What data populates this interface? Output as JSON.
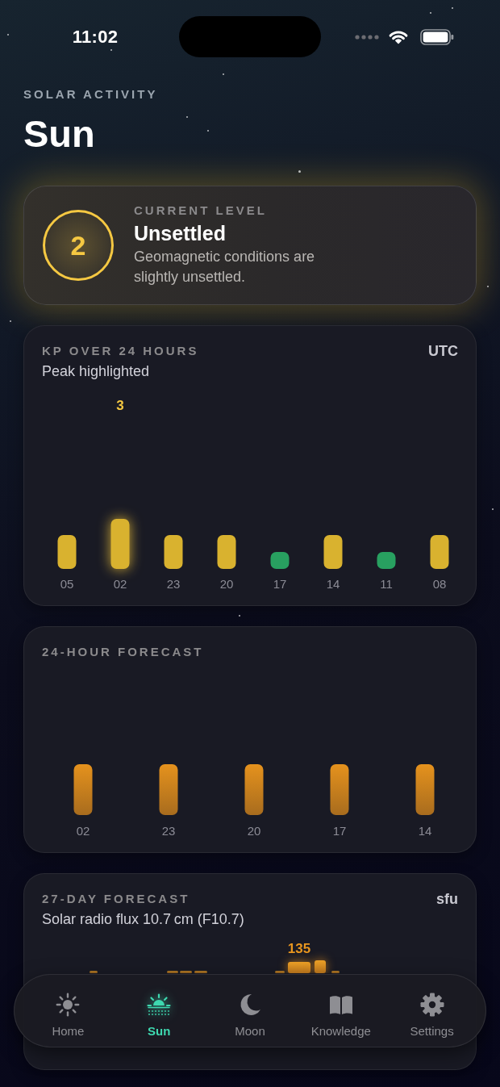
{
  "status_bar": {
    "time": "11:02"
  },
  "header": {
    "eyebrow": "SOLAR ACTIVITY",
    "title": "Sun"
  },
  "current_level": {
    "value": "2",
    "eyebrow": "CURRENT LEVEL",
    "title": "Unsettled",
    "description": "Geomagnetic conditions are slightly unsettled."
  },
  "kp_card": {
    "title": "KP OVER 24 HOURS",
    "unit": "UTC",
    "subtitle": "Peak highlighted",
    "peak_label": "3",
    "bars": [
      {
        "hour": "05",
        "color": "#d9b22f",
        "highlighted": false
      },
      {
        "hour": "02",
        "color": "#d9b22f",
        "highlighted": true
      },
      {
        "hour": "23",
        "color": "#d9b22f",
        "highlighted": false
      },
      {
        "hour": "20",
        "color": "#d9b22f",
        "highlighted": false
      },
      {
        "hour": "17",
        "color": "#28a060",
        "highlighted": false
      },
      {
        "hour": "14",
        "color": "#d9b22f",
        "highlighted": false
      },
      {
        "hour": "11",
        "color": "#28a060",
        "highlighted": false
      },
      {
        "hour": "08",
        "color": "#d9b22f",
        "highlighted": false
      }
    ]
  },
  "forecast_24h": {
    "title": "24-HOUR FORECAST",
    "hours": [
      "02",
      "23",
      "20",
      "17",
      "14"
    ]
  },
  "forecast_27d": {
    "title": "27-DAY FORECAST",
    "unit": "sfu",
    "subtitle": "Solar radio flux 10.7 cm (F10.7)",
    "peak_label": "135"
  },
  "tab_bar": {
    "tabs": [
      {
        "label": "Home",
        "selected": false
      },
      {
        "label": "Sun",
        "selected": true
      },
      {
        "label": "Moon",
        "selected": false
      },
      {
        "label": "Knowledge",
        "selected": false
      },
      {
        "label": "Settings",
        "selected": false
      }
    ]
  }
}
